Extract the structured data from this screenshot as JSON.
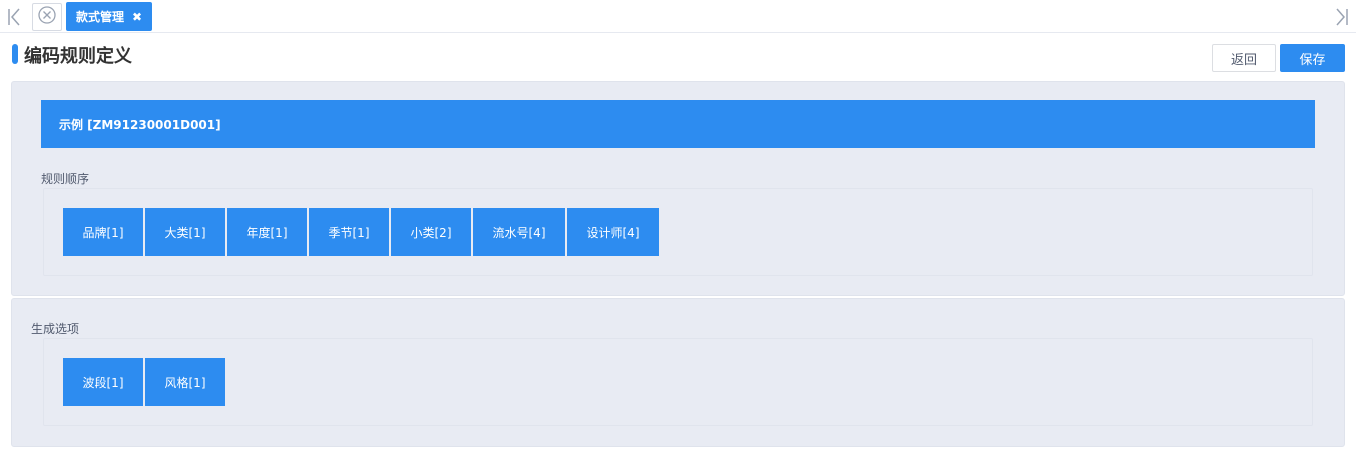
{
  "tabs": {
    "active_label": "款式管理",
    "close_glyph": "✖"
  },
  "page": {
    "title": "编码规则定义",
    "back_label": "返回",
    "save_label": "保存"
  },
  "example": {
    "text": "示例 [ZM91230001D001]"
  },
  "rule_order": {
    "label": "规则顺序",
    "items": [
      "品牌[1]",
      "大类[1]",
      "年度[1]",
      "季节[1]",
      "小类[2]",
      "流水号[4]",
      "设计师[4]"
    ]
  },
  "generate_options": {
    "label": "生成选项",
    "items": [
      "波段[1]",
      "风格[1]"
    ]
  },
  "colors": {
    "accent": "#2d8cf0",
    "panel_bg": "#e8ebf3"
  },
  "icons": {
    "nav_left": "double-chevron-left-icon",
    "nav_right": "double-chevron-right-icon",
    "close_all": "circle-close-icon",
    "tab_close": "close-icon"
  }
}
